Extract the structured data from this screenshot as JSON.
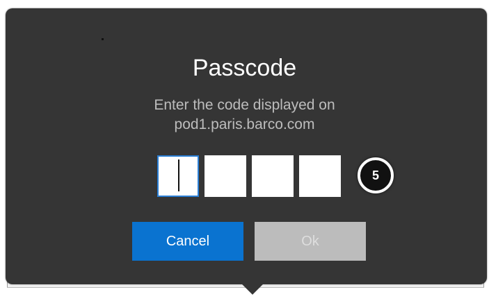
{
  "dialog": {
    "title": "Passcode",
    "instruction_line1": "Enter the code displayed on",
    "instruction_line2": "pod1.paris.barco.com",
    "code_digits": [
      "",
      "",
      "",
      ""
    ],
    "active_digit_index": 0,
    "step_badge": "5",
    "cancel_label": "Cancel",
    "ok_label": "Ok",
    "ok_enabled": false
  },
  "colors": {
    "dialog_bg": "#353535",
    "accent": "#0a73d0",
    "disabled_button": "#bcbcbc",
    "active_border": "#2a7fd6"
  }
}
